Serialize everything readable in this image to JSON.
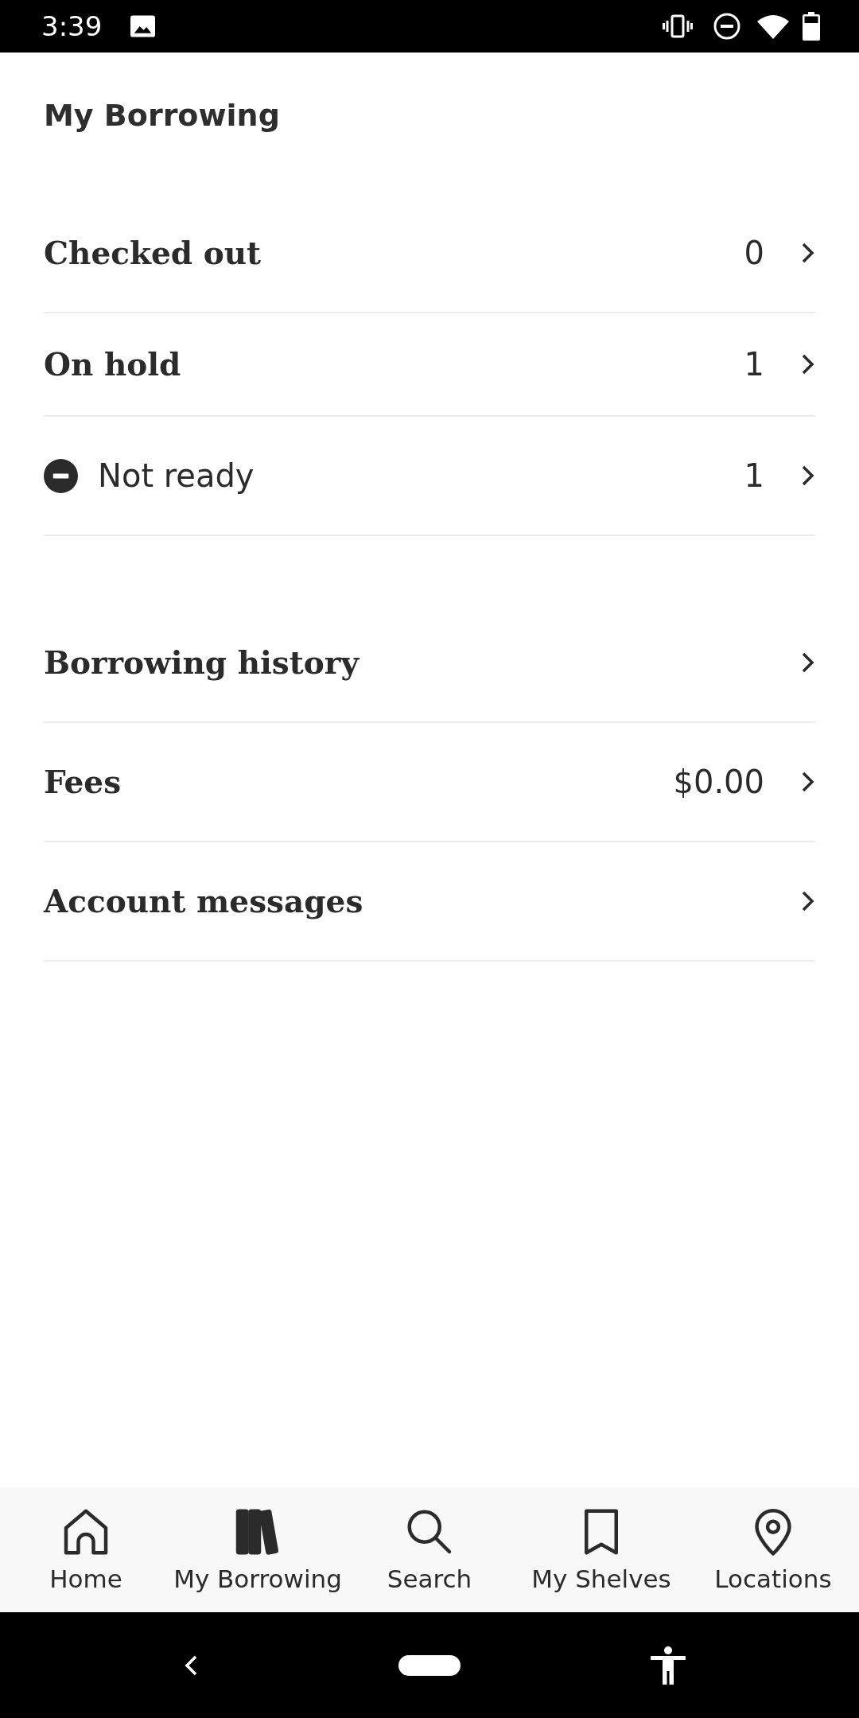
{
  "status_bar": {
    "time": "3:39"
  },
  "header": {
    "title": "My Borrowing"
  },
  "sections": [
    {
      "rows": [
        {
          "label": "Checked out",
          "count": "0"
        },
        {
          "label": "On hold",
          "count": "1",
          "children": [
            {
              "label": "Not ready",
              "count": "1"
            }
          ]
        }
      ]
    },
    {
      "rows": [
        {
          "label": "Borrowing history"
        },
        {
          "label": "Fees",
          "count": "$0.00"
        },
        {
          "label": "Account messages"
        }
      ]
    }
  ],
  "bottom_nav": [
    {
      "label": "Home",
      "selected": false
    },
    {
      "label": "My Borrowing",
      "selected": true
    },
    {
      "label": "Search",
      "selected": false
    },
    {
      "label": "My Shelves",
      "selected": false
    },
    {
      "label": "Locations",
      "selected": false
    }
  ]
}
